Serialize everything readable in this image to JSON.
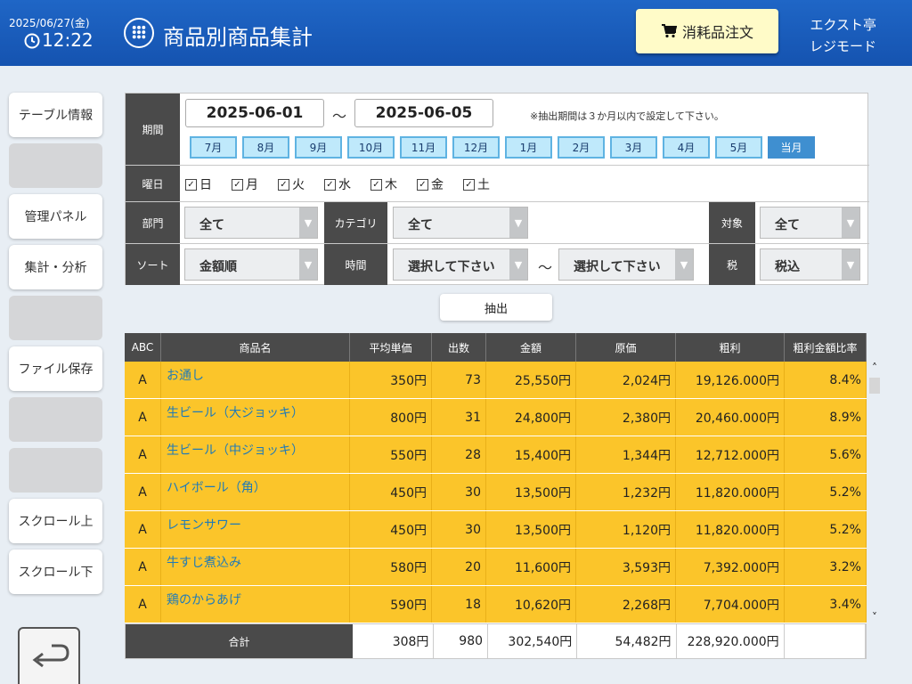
{
  "header": {
    "date": "2025/06/27(金)",
    "time": "12:22",
    "title": "商品別商品集計",
    "order_button": "消耗品注文",
    "store": "エクスト亭",
    "mode": "レジモード"
  },
  "sidebar": {
    "items": [
      "テーブル情報",
      "",
      "管理パネル",
      "集計・分析",
      "",
      "ファイル保存",
      "",
      "",
      "スクロール上",
      "スクロール下"
    ]
  },
  "filter": {
    "period_label": "期間",
    "date_from": "2025-06-01",
    "tilde": "～",
    "date_to": "2025-06-05",
    "note": "※抽出期間は３か月以内で設定して下さい。",
    "months": [
      "7月",
      "8月",
      "9月",
      "10月",
      "11月",
      "12月",
      "1月",
      "2月",
      "3月",
      "4月",
      "5月",
      "当月"
    ],
    "active_month": "当月",
    "dow_label": "曜日",
    "days": [
      "日",
      "月",
      "火",
      "水",
      "木",
      "金",
      "土"
    ],
    "dept_label": "部門",
    "dept_value": "全て",
    "category_label": "カテゴリ",
    "category_value": "全て",
    "target_label": "対象",
    "target_value": "全て",
    "sort_label": "ソート",
    "sort_value": "金額順",
    "time_label": "時間",
    "time_from": "選択して下さい",
    "time_to": "選択して下さい",
    "tax_label": "税",
    "tax_value": "税込"
  },
  "extract_button": "抽出",
  "table": {
    "headers": [
      "ABC",
      "商品名",
      "平均単価",
      "出数",
      "金額",
      "原価",
      "粗利",
      "粗利金額比率"
    ],
    "rows": [
      [
        "A",
        "お通し",
        "350円",
        "73",
        "25,550円",
        "2,024円",
        "19,126.000円",
        "8.4%"
      ],
      [
        "A",
        "生ビール（大ジョッキ）",
        "800円",
        "31",
        "24,800円",
        "2,380円",
        "20,460.000円",
        "8.9%"
      ],
      [
        "A",
        "生ビール（中ジョッキ）",
        "550円",
        "28",
        "15,400円",
        "1,344円",
        "12,712.000円",
        "5.6%"
      ],
      [
        "A",
        "ハイボール（角）",
        "450円",
        "30",
        "13,500円",
        "1,232円",
        "11,820.000円",
        "5.2%"
      ],
      [
        "A",
        "レモンサワー",
        "450円",
        "30",
        "13,500円",
        "1,120円",
        "11,820.000円",
        "5.2%"
      ],
      [
        "A",
        "牛すじ煮込み",
        "580円",
        "20",
        "11,600円",
        "3,593円",
        "7,392.000円",
        "3.2%"
      ],
      [
        "A",
        "鶏のからあげ",
        "590円",
        "18",
        "10,620円",
        "2,268円",
        "7,704.000円",
        "3.4%"
      ]
    ],
    "total": {
      "label": "合計",
      "avg": "308円",
      "count": "980",
      "amount": "302,540円",
      "cost": "54,482円",
      "profit": "228,920.000円",
      "ratio": ""
    }
  },
  "colors": {
    "header_bg": "#1a5cbb",
    "row_bg": "#fbc52a",
    "link_text": "#1f7ab8",
    "month_active": "#3f8fd0"
  }
}
